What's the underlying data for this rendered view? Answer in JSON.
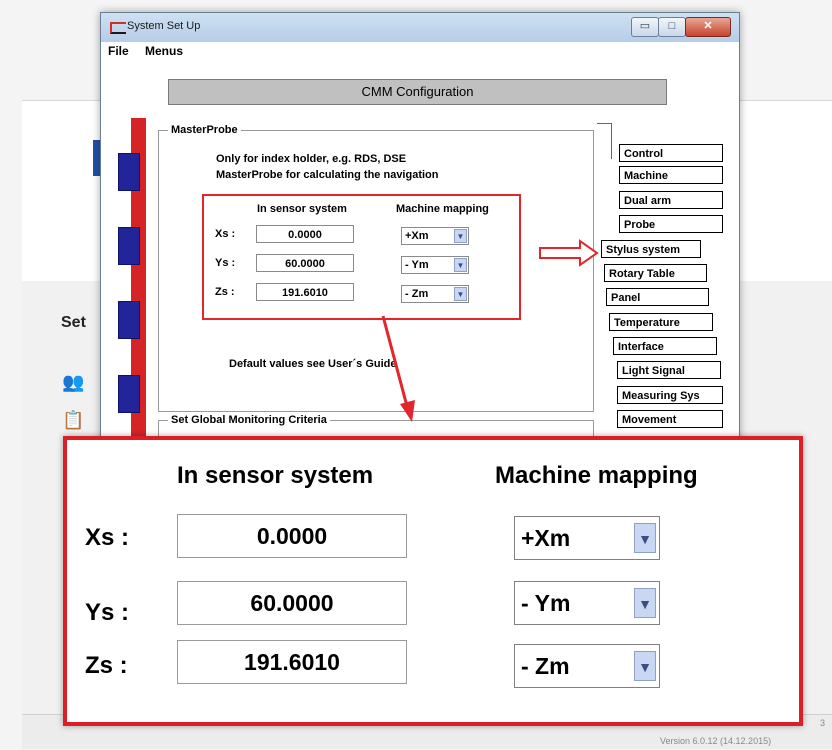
{
  "window": {
    "title": "System Set Up",
    "menus": [
      "File",
      "Menus"
    ],
    "controls": {
      "minimize": "▭",
      "maximize": "□",
      "close": "✕"
    }
  },
  "config_title": "CMM Configuration",
  "masterprobe": {
    "legend": "MasterProbe",
    "note_line1": "Only for index holder, e.g. RDS, DSE",
    "note_line2": "MasterProbe for calculating the navigation",
    "header_sensor": "In sensor system",
    "header_mapping": "Machine mapping",
    "rows": [
      {
        "label": "Xs :",
        "value": "0.0000",
        "mapping": "+Xm"
      },
      {
        "label": "Ys :",
        "value": "60.0000",
        "mapping": "- Ym"
      },
      {
        "label": "Zs :",
        "value": "191.6010",
        "mapping": "- Zm"
      }
    ],
    "default_note": "Default values see User´s Guide"
  },
  "global_monitoring": {
    "legend": "Set Global Monitoring Criteria"
  },
  "tabs": [
    "Control",
    "Machine",
    "Dual arm",
    "Probe",
    "Stylus system",
    "Rotary Table",
    "Panel",
    "Temperature",
    "Interface",
    "Light Signal",
    "Measuring Sys",
    "Movement"
  ],
  "active_tab": "Stylus system",
  "zoom": {
    "header_sensor": "In sensor system",
    "header_mapping": "Machine mapping",
    "rows": [
      {
        "label": "Xs :",
        "value": "0.0000",
        "mapping": "+Xm"
      },
      {
        "label": "Ys :",
        "value": "60.0000",
        "mapping": "- Ym"
      },
      {
        "label": "Zs :",
        "value": "191.6010",
        "mapping": "- Zm"
      }
    ]
  },
  "background": {
    "set_label": "Set",
    "version": "Version 6.0.12 (14.12.2015)",
    "page_number": "3"
  },
  "colors": {
    "highlight": "#e3262b",
    "binder": "#d52425",
    "ring": "#22249a"
  }
}
